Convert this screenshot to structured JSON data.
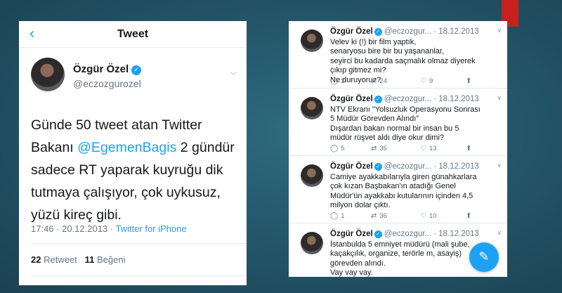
{
  "left": {
    "back_icon": "chevron-left-icon",
    "title": "Tweet",
    "user": {
      "name": "Özgür Özel",
      "handle": "@eczozgurozel"
    },
    "body_before": "Günde 50 tweet atan Twitter Bakanı ",
    "body_mention": "@EgemenBagis",
    "body_after": " 2 gündür sadece RT yaparak kuyruğu dik tutmaya çalışıyor, çok uykusuz, yüzü kireç gibi.",
    "meta_time": "17:46 · 20.12.2013 · ",
    "meta_source": "Twitter for iPhone",
    "retweet_count": "22",
    "retweet_label": "Retweet",
    "like_count": "11",
    "like_label": "Beğeni"
  },
  "right": {
    "tweets": [
      {
        "name": "Özgür Özel",
        "handle": "@eczozgur...",
        "date": "· 18.12.2013",
        "text": "Velev ki (!) bir film yaptık,\nsenaryosu bire bir bu yaşananlar,\nseyirci bu kadarda saçmalık olmaz diyerek\nçıkıp gitmez mi?\nNe duruyoruz?",
        "replies": "2",
        "retweets": "24",
        "likes": "9"
      },
      {
        "name": "Özgür Özel",
        "handle": "@eczozgur...",
        "date": "· 18.12.2013",
        "text": "NTV Ekranı \"Yolsuzluk Operasyonu Sonrası\n5 Müdür Görevden Alındı\"\nDışardan bakan normal bir  insan bu 5\nmüdür rüşvet aldı diye okur dimi?",
        "replies": "5",
        "retweets": "35",
        "likes": "13"
      },
      {
        "name": "Özgür Özel",
        "handle": "@eczozgur...",
        "date": "· 18.12.2013",
        "text": "Camiye ayakkabılarıyla giren günahkarlara\nçok kızan Başbakan'ın atadığı Genel\nMüdür'ün ayakkabı kutularının içinden 4,5\nmilyon dolar çıktı.",
        "replies": "1",
        "retweets": "36",
        "likes": "10"
      },
      {
        "name": "Özgür Özel",
        "handle": "@eczozgur...",
        "date": "· 18.12.2013",
        "text": "İstanbulda 5 emniyet müdürü (mali şube,\nkaçakçılık, organize, terörle m, asayiş)\ngörevden alındı.\nVay vay vay."
      }
    ],
    "compose_icon": "compose-feather-icon"
  },
  "colors": {
    "accent": "#1da1f2",
    "background": "#24576a",
    "corner_tab": "#c8201c"
  }
}
